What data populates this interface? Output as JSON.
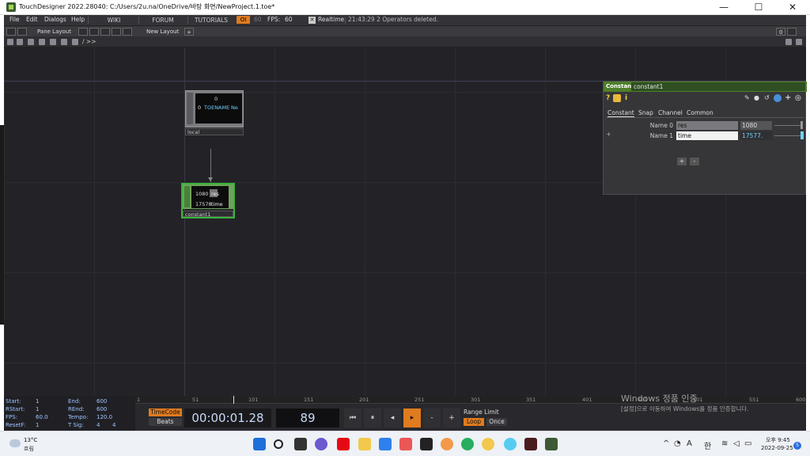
{
  "window": {
    "title": "TouchDesigner 2022.28040: C:/Users/2u.na/OneDrive/바탕 화면/NewProject.1.toe*",
    "minimize": "—",
    "maximize": "☐",
    "close": "✕"
  },
  "menubar": {
    "items": [
      "File",
      "Edit",
      "Dialogs",
      "Help"
    ],
    "links": [
      "WIKI",
      "FORUM",
      "TUTORIALS"
    ],
    "ol_badge": "OI",
    "ol_value": "60",
    "fps_label": "FPS:",
    "fps_value": "60",
    "realtime_label": "Realtime",
    "realtime_check": "✕",
    "status_message": "21:43:29 2 Operators deleted."
  },
  "panebar": {
    "pane_layout": "Pane Layout",
    "new_layout": "New Layout",
    "add": "+",
    "right_value": "0"
  },
  "pathbar": {
    "path": "/ >>"
  },
  "nodes": {
    "local": {
      "label": "local",
      "viewer_top": "0",
      "viewer_index": "0",
      "viewer_name": "TOENAME",
      "viewer_trail": "Ne"
    },
    "constant1": {
      "label": "constant1",
      "rows": [
        {
          "value": "1080",
          "name": "res"
        },
        {
          "value": "17578",
          "name": "time"
        }
      ]
    }
  },
  "params": {
    "type": "Constant",
    "name": "constant1",
    "tabs": [
      "Constant",
      "Snap",
      "Channel",
      "Common"
    ],
    "rows": [
      {
        "label": "Name 0",
        "name": "res",
        "value": "1080"
      },
      {
        "label": "Name 1",
        "name": "time",
        "value": "17577."
      }
    ],
    "add": "+",
    "remove": "-",
    "row_plus": "+"
  },
  "timeline": {
    "stats": {
      "start_label": "Start:",
      "start": "1",
      "end_label": "End:",
      "end": "600",
      "rstart_label": "RStart:",
      "rstart": "1",
      "rend_label": "REnd:",
      "rend": "600",
      "fps_label": "FPS:",
      "fps": "60.0",
      "tempo_label": "Tempo:",
      "tempo": "120.0",
      "resetf_label": "ResetF:",
      "resetf": "1",
      "tsig_label": "T Sig:",
      "tsig_a": "4",
      "tsig_b": "4"
    },
    "ruler_ticks": [
      "1",
      "51",
      "101",
      "151",
      "201",
      "251",
      "301",
      "351",
      "401",
      "451",
      "501",
      "551",
      "600"
    ],
    "timecode_label": "TimeCode",
    "beats_label": "Beats",
    "timecode": "00:00:01.28",
    "frame": "89",
    "range_limit": "Range Limit",
    "loop": "Loop",
    "once": "Once"
  },
  "watermark": {
    "title": "Windows 정품 인증",
    "subtitle": "[설정]으로 이동하여 Windows를 정품 인증합니다."
  },
  "taskbar": {
    "temp": "13°C",
    "weather": "흐림",
    "lang": "A",
    "ime": "한",
    "time": "오후 9:45",
    "date": "2022-09-25",
    "notifications": "5"
  }
}
